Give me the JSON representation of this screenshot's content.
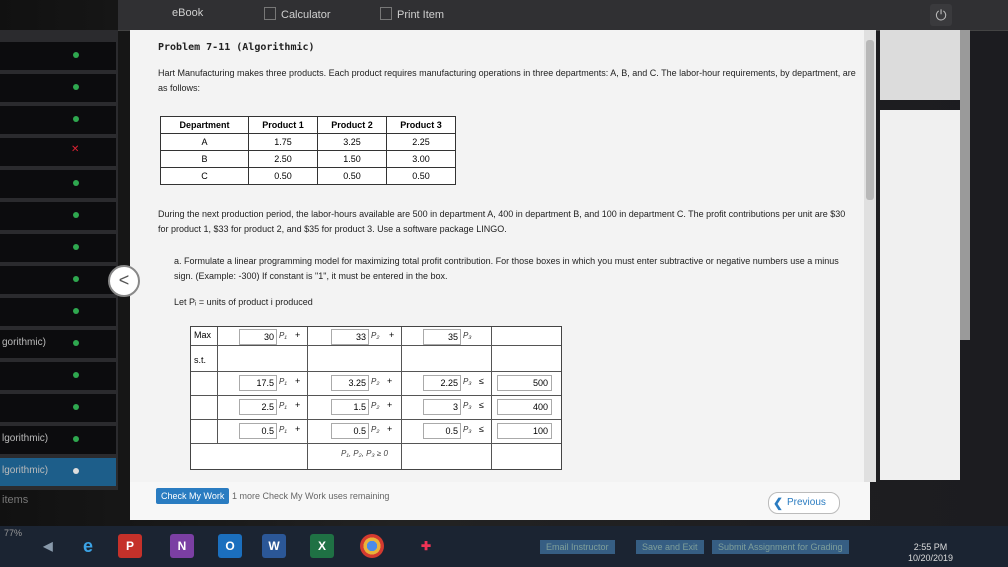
{
  "toolbar": {
    "ebook": "eBook",
    "calculator": "Calculator",
    "print": "Print Item"
  },
  "sidebar": {
    "items": [
      {
        "label": "",
        "status": "check"
      },
      {
        "label": "",
        "status": "check"
      },
      {
        "label": "",
        "status": "check"
      },
      {
        "label": "",
        "status": "x"
      },
      {
        "label": "",
        "status": "check"
      },
      {
        "label": "",
        "status": "check"
      },
      {
        "label": "",
        "status": "check"
      },
      {
        "label": "",
        "status": "check"
      },
      {
        "label": "",
        "status": "check"
      },
      {
        "label": "gorithmic)",
        "status": "check"
      },
      {
        "label": "",
        "status": "check"
      },
      {
        "label": "",
        "status": "check"
      },
      {
        "label": "lgorithmic)",
        "status": "check"
      },
      {
        "label": "lgorithmic)",
        "status": "active"
      }
    ],
    "items_label": "items"
  },
  "problem": {
    "title": "Problem 7-11 (Algorithmic)",
    "intro": "Hart Manufacturing makes three products. Each product requires manufacturing operations in three departments: A, B, and C. The labor-hour requirements, by department, are as follows:",
    "table": {
      "headers": [
        "Department",
        "Product 1",
        "Product 2",
        "Product 3"
      ],
      "rows": [
        [
          "A",
          "1.75",
          "3.25",
          "2.25"
        ],
        [
          "B",
          "2.50",
          "1.50",
          "3.00"
        ],
        [
          "C",
          "0.50",
          "0.50",
          "0.50"
        ]
      ]
    },
    "para2": "During the next production period, the labor-hours available are 500 in department A, 400 in department B, and 100 in department C. The profit contributions per unit are $30 for product 1, $33 for product 2, and $35 for product 3. Use a software package LINGO.",
    "part_a": "a. Formulate a linear programming model for maximizing total profit contribution. For those boxes in which you must enter subtractive or negative numbers use a minus sign. (Example: -300) If constant is \"1\", it must be entered in the box.",
    "let_p": "Let Pᵢ = units of product i produced"
  },
  "model": {
    "max_label": "Max",
    "st_label": "s.t.",
    "objective": [
      "30",
      "33",
      "35"
    ],
    "constraints": [
      {
        "coefs": [
          "17.5",
          "3.25",
          "2.25"
        ],
        "sign": "≤",
        "rhs": "500"
      },
      {
        "coefs": [
          "2.5",
          "1.5",
          "3"
        ],
        "sign": "≤",
        "rhs": "400"
      },
      {
        "coefs": [
          "0.5",
          "0.5",
          "0.5"
        ],
        "sign": "≤",
        "rhs": "100"
      }
    ],
    "vars": [
      "P₁",
      "P₂",
      "P₃"
    ],
    "plus": "+",
    "nonneg": "P₁, P₂, P₃ ≥ 0"
  },
  "bottom": {
    "check_btn": "Check My Work",
    "remaining": "1 more Check My Work uses remaining",
    "previous": "Previous"
  },
  "actions": {
    "email": "Email Instructor",
    "save": "Save and Exit",
    "submit": "Submit Assignment for Grading"
  },
  "taskbar": {
    "clock_time": "2:55 PM",
    "clock_date": "10/20/2019",
    "pct": "77%"
  }
}
